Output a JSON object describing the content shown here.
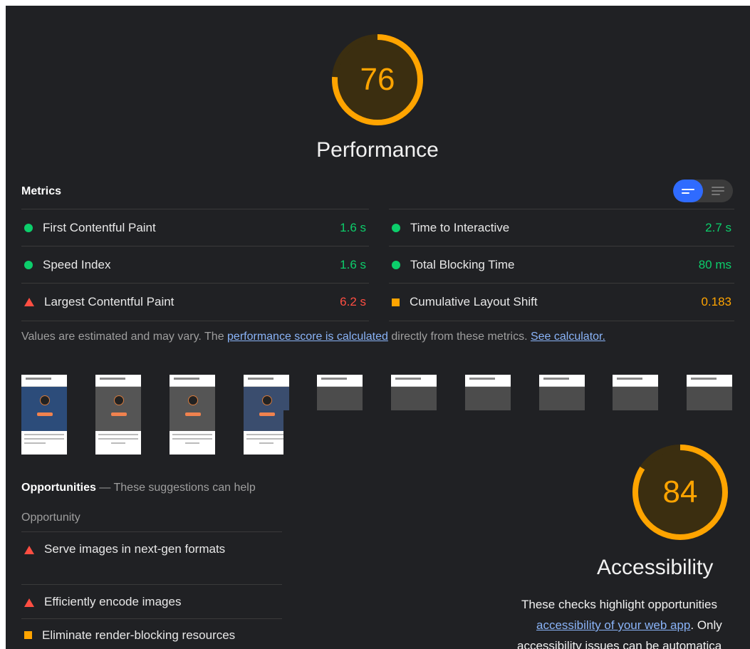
{
  "performance": {
    "score": "76",
    "score_value": 76,
    "title": "Performance"
  },
  "metrics": {
    "title": "Metrics",
    "left": [
      {
        "label": "First Contentful Paint",
        "value": "1.6 s",
        "status": "good"
      },
      {
        "label": "Speed Index",
        "value": "1.6 s",
        "status": "good"
      },
      {
        "label": "Largest Contentful Paint",
        "value": "6.2 s",
        "status": "bad"
      }
    ],
    "right": [
      {
        "label": "Time to Interactive",
        "value": "2.7 s",
        "status": "good"
      },
      {
        "label": "Total Blocking Time",
        "value": "80 ms",
        "status": "good"
      },
      {
        "label": "Cumulative Layout Shift",
        "value": "0.183",
        "status": "average"
      }
    ],
    "note_prefix": "Values are estimated and may vary. The ",
    "note_link1": "performance score is calculated",
    "note_middle": " directly from these metrics. ",
    "note_link2": "See calculator."
  },
  "opportunities": {
    "title": "Opportunities",
    "subtitle": " — These suggestions can help",
    "column": "Opportunity",
    "items": [
      {
        "label": "Serve images in next-gen formats",
        "status": "bad"
      },
      {
        "label": "Efficiently encode images",
        "status": "bad"
      },
      {
        "label": "Eliminate render-blocking resources",
        "status": "average"
      }
    ]
  },
  "accessibility": {
    "score": "84",
    "score_value": 84,
    "title": "Accessibility",
    "desc_line1": "These checks highlight opportunities",
    "desc_link": "accessibility of your web app",
    "desc_line2_suffix": ". Only",
    "desc_line3": "accessibility issues can be automatica"
  },
  "colors": {
    "good": "#0cce6b",
    "average": "#ffa400",
    "bad": "#ff4e42",
    "link": "#8ab4f8",
    "toggle_active": "#2f6bff"
  }
}
